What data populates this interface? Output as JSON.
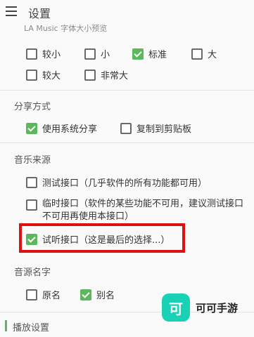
{
  "header": {
    "title": "设置",
    "preview_text": "LA Music 字体大小预览"
  },
  "font_size": {
    "options": [
      {
        "label": "较小",
        "checked": false
      },
      {
        "label": "小",
        "checked": false
      },
      {
        "label": "标准",
        "checked": true
      },
      {
        "label": "大",
        "checked": false
      },
      {
        "label": "较大",
        "checked": false
      },
      {
        "label": "非常大",
        "checked": false
      }
    ]
  },
  "share": {
    "title": "分享方式",
    "options": [
      {
        "label": "使用系统分享",
        "checked": true
      },
      {
        "label": "复制到剪贴板",
        "checked": false
      }
    ]
  },
  "music_source": {
    "title": "音乐来源",
    "options": [
      {
        "label": "测试接口（几乎软件的所有功能都可用）",
        "checked": false
      },
      {
        "label": "临时接口（软件的某些功能不可用，建议测试接口不可用再使用本接口）",
        "checked": false
      },
      {
        "label": "试听接口（这是最后的选择...）",
        "checked": true
      }
    ]
  },
  "source_name": {
    "title": "音源名字",
    "options": [
      {
        "label": "原名",
        "checked": false
      },
      {
        "label": "别名",
        "checked": true
      }
    ]
  },
  "playback": {
    "title": "播放设置"
  },
  "watermark": {
    "logo_char": "可",
    "text": "可可手游"
  },
  "colors": {
    "accent": "#5cb85c",
    "highlight": "#e01010",
    "watermark": "#19d1b5"
  }
}
